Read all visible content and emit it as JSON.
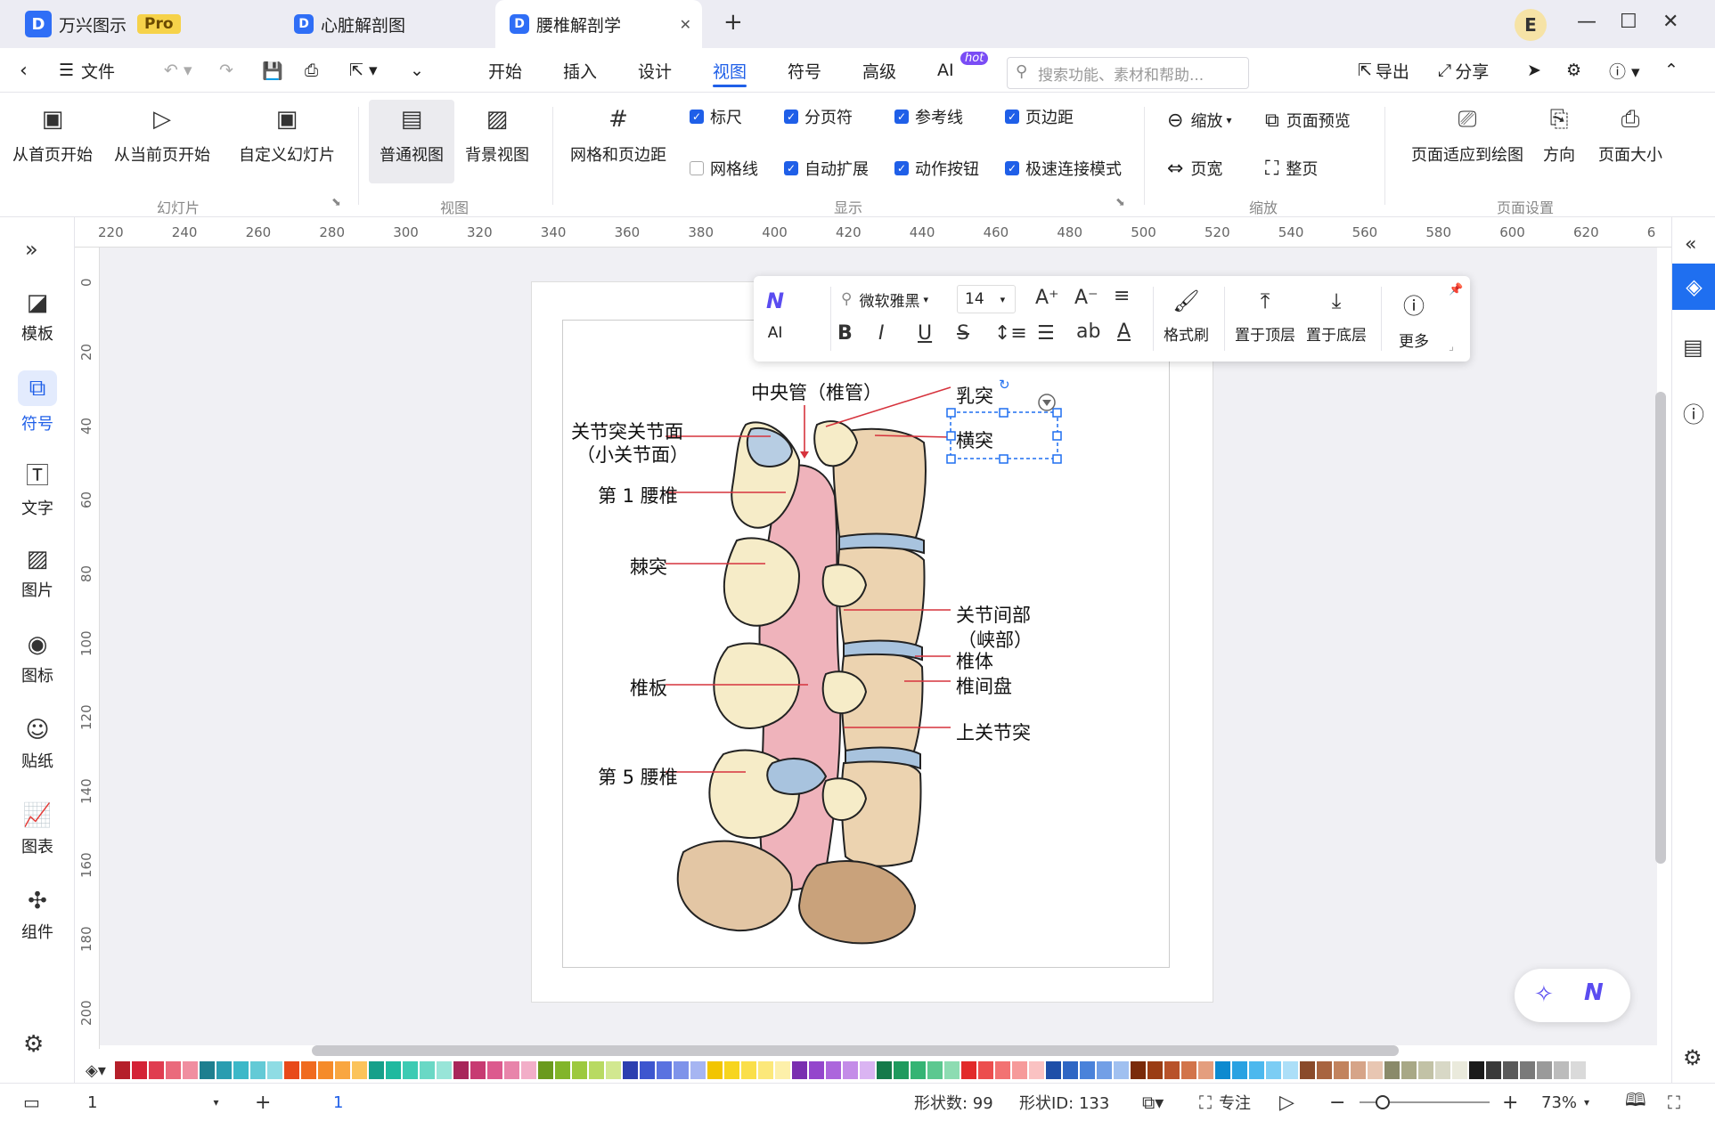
{
  "app": {
    "name": "万兴图示",
    "badge": "Pro"
  },
  "tabs": [
    {
      "label": "心脏解剖图"
    },
    {
      "label": "腰椎解剖学"
    }
  ],
  "user_initial": "E",
  "menu": {
    "file": "文件",
    "items": [
      "开始",
      "插入",
      "设计",
      "视图",
      "符号",
      "高级",
      "AI"
    ],
    "active": "视图",
    "hot_badge": "hot",
    "search_placeholder": "搜索功能、素材和帮助...",
    "export": "导出",
    "share": "分享"
  },
  "ribbon": {
    "slideshow": {
      "from_first": "从首页开始",
      "from_current": "从当前页开始",
      "custom": "自定义幻灯片",
      "group": "幻灯片"
    },
    "view": {
      "normal": "普通视图",
      "background": "背景视图",
      "group": "视图"
    },
    "grid_margin": "网格和页边距",
    "display": {
      "ruler": "标尺",
      "page_break": "分页符",
      "guides": "参考线",
      "margin": "页边距",
      "gridlines": "网格线",
      "auto_expand": "自动扩展",
      "action_buttons": "动作按钮",
      "fast_connect": "极速连接模式",
      "group": "显示"
    },
    "zoom": {
      "zoom": "缩放",
      "preview": "页面预览",
      "page_width": "页宽",
      "whole_page": "整页",
      "group": "缩放"
    },
    "page_setup": {
      "fit": "页面适应到绘图",
      "direction": "方向",
      "size": "页面大小",
      "group": "页面设置"
    }
  },
  "leftbar": [
    "模板",
    "符号",
    "文字",
    "图片",
    "图标",
    "贴纸",
    "图表",
    "组件"
  ],
  "leftbar_active": "符号",
  "ruler_h": [
    "220",
    "240",
    "260",
    "280",
    "300",
    "320",
    "340",
    "360",
    "380",
    "400",
    "420",
    "440",
    "460",
    "480",
    "500",
    "520",
    "540",
    "560",
    "580",
    "600",
    "620",
    "6"
  ],
  "ruler_v": [
    "0",
    "20",
    "40",
    "60",
    "80",
    "100",
    "120",
    "140",
    "160",
    "180",
    "200"
  ],
  "floatbar": {
    "ai": "AI",
    "font": "微软雅黑",
    "size": "14",
    "format_painter": "格式刷",
    "to_top": "置于顶层",
    "to_bottom": "置于底层",
    "more": "更多"
  },
  "diagram_labels": {
    "central_canal": "中央管（椎管）",
    "mastoid": "乳突",
    "transverse": "横突",
    "facet_surface_1": "关节突关节面",
    "facet_surface_2": "（小关节面）",
    "l1": "第 1 腰椎",
    "spinous": "棘突",
    "pars_1": "关节间部",
    "pars_2": "（峡部）",
    "body": "椎体",
    "disc": "椎间盘",
    "lamina": "椎板",
    "superior_facet": "上关节突",
    "l5": "第 5 腰椎"
  },
  "palette": [
    "#b51f2a",
    "#d42236",
    "#e03c50",
    "#ea6a7c",
    "#f08ea0",
    "#1e7f8f",
    "#2a9db0",
    "#3cb8c8",
    "#63cad6",
    "#8fdce4",
    "#e84a1a",
    "#f06b1f",
    "#f58b2a",
    "#f9a640",
    "#fbc35a",
    "#16a08a",
    "#1fb99f",
    "#3dcbb3",
    "#6ad8c5",
    "#98e5d8",
    "#a8265a",
    "#c73a72",
    "#dc5a8e",
    "#e884aa",
    "#f2aec8",
    "#6a9a1e",
    "#82b52a",
    "#9dc93e",
    "#b8da62",
    "#d2e890",
    "#2c3fb0",
    "#3d56cf",
    "#5a72e0",
    "#7e93ea",
    "#a6b5f2",
    "#f2c500",
    "#f7d51e",
    "#fadf4a",
    "#fce87a",
    "#fdf0aa",
    "#7a2fb0",
    "#9446cc",
    "#ac66dc",
    "#c48ce8",
    "#dab4f2",
    "#157a4a",
    "#1f9a5e",
    "#35b474",
    "#5cc890",
    "#8ddcb2",
    "#e22a2a",
    "#ec4e4e",
    "#f27272",
    "#f69a9a",
    "#fac2c2",
    "#1f4fa8",
    "#2e66c4",
    "#4a82da",
    "#729fe6",
    "#a0c0f0",
    "#7a2a0a",
    "#9a3c14",
    "#b8522a",
    "#d2744a",
    "#e49e7e",
    "#0d8ad0",
    "#2aa2e2",
    "#4cb8ee",
    "#7ccdf4",
    "#acdff8",
    "#8a4a2a",
    "#a86440",
    "#c2835e",
    "#d6a488",
    "#e8c6b2",
    "#8a8a6a",
    "#a8a886",
    "#c2c2a6",
    "#d8d8c6",
    "#eaeadc",
    "#1a1a1a",
    "#3a3a3a",
    "#5a5a5a",
    "#7a7a7a",
    "#9a9a9a",
    "#bcbcbc",
    "#dadada"
  ],
  "status": {
    "page_num": "1",
    "page_tab": "1",
    "shape_count": "形状数: 99",
    "shape_id": "形状ID: 133",
    "focus": "专注",
    "zoom": "73%"
  }
}
